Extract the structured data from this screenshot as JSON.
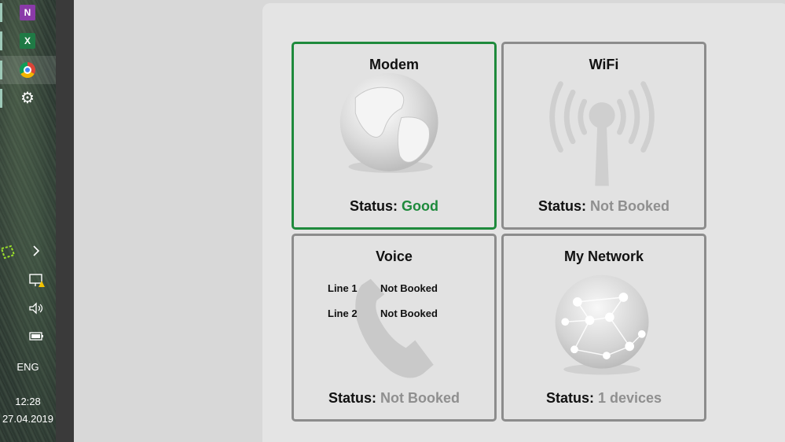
{
  "taskbar": {
    "apps": [
      {
        "name": "OneNote",
        "icon": "onenote-icon",
        "glyph": "N"
      },
      {
        "name": "Excel",
        "icon": "excel-icon",
        "glyph": "X"
      },
      {
        "name": "Chrome",
        "icon": "chrome-icon"
      },
      {
        "name": "Settings",
        "icon": "gear-icon",
        "glyph": "⚙"
      }
    ],
    "tray": {
      "language": "ENG",
      "time": "12:28",
      "date": "27.04.2019"
    }
  },
  "cards": {
    "modem": {
      "title": "Modem",
      "status_label": "Status:",
      "status_value": "Good",
      "status_color": "#1e8a3c",
      "icon": "globe-icon"
    },
    "wifi": {
      "title": "WiFi",
      "status_label": "Status:",
      "status_value": "Not Booked",
      "status_color": "#8f8f8f",
      "icon": "wifi-antenna-icon"
    },
    "voice": {
      "title": "Voice",
      "status_label": "Status:",
      "status_value": "Not Booked",
      "status_color": "#8f8f8f",
      "icon": "phone-handset-icon",
      "lines": [
        {
          "label": "Line 1",
          "value": "Not Booked"
        },
        {
          "label": "Line 2",
          "value": "Not Booked"
        }
      ]
    },
    "network": {
      "title": "My Network",
      "status_label": "Status:",
      "status_value": "1 devices",
      "status_color": "#8f8f8f",
      "icon": "network-sphere-icon"
    }
  },
  "colors": {
    "selected_border": "#1e8a3c",
    "card_border": "#8c8c8c"
  }
}
